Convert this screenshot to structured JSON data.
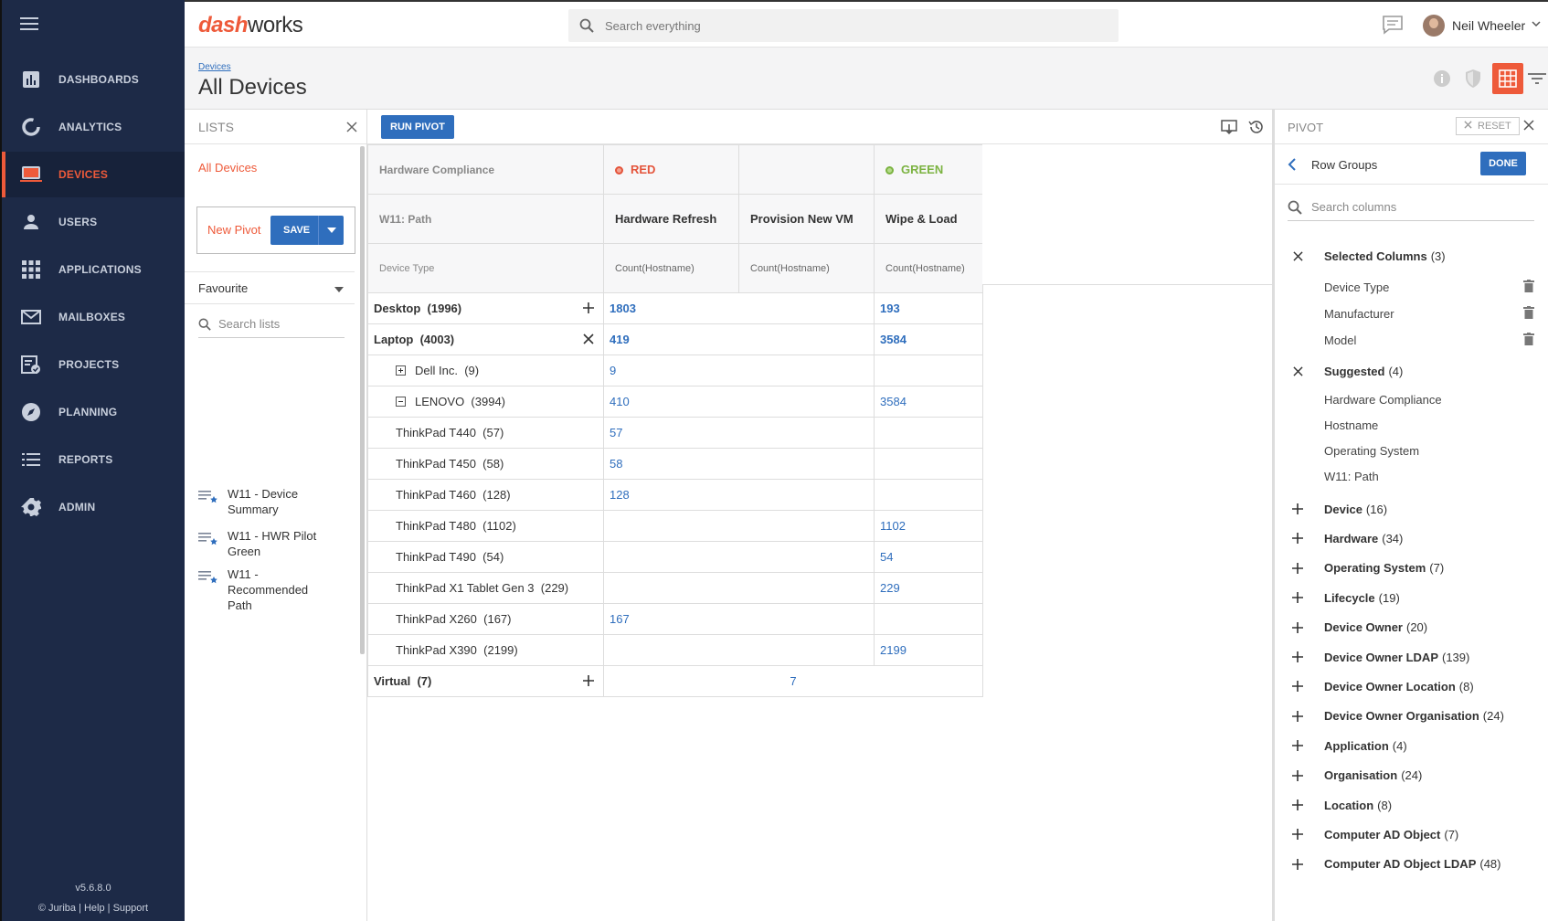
{
  "sidebar": {
    "menu_icon": "hamburger-icon",
    "items": [
      {
        "label": "DASHBOARDS",
        "icon": "bar-chart-icon"
      },
      {
        "label": "ANALYTICS",
        "icon": "donut-icon"
      },
      {
        "label": "DEVICES",
        "icon": "laptop-icon"
      },
      {
        "label": "USERS",
        "icon": "person-icon"
      },
      {
        "label": "APPLICATIONS",
        "icon": "apps-grid-icon"
      },
      {
        "label": "MAILBOXES",
        "icon": "mail-icon"
      },
      {
        "label": "PROJECTS",
        "icon": "clipboard-check-icon"
      },
      {
        "label": "PLANNING",
        "icon": "compass-icon"
      },
      {
        "label": "REPORTS",
        "icon": "list-icon"
      },
      {
        "label": "ADMIN",
        "icon": "gear-icon"
      }
    ],
    "active": "DEVICES",
    "version": "v5.6.8.0",
    "footer": "© Juriba | Help | Support"
  },
  "topbar": {
    "logo_a": "dash",
    "logo_b": "works",
    "search_placeholder": "Search everything",
    "user_name": "Neil Wheeler"
  },
  "header": {
    "breadcrumb": "Devices",
    "title": "All Devices"
  },
  "lists": {
    "title": "LISTS",
    "all_devices": "All Devices",
    "new_pivot": "New Pivot",
    "save": "SAVE",
    "favourite": "Favourite",
    "search_placeholder": "Search lists",
    "entries": [
      {
        "line1": "W11 - Device",
        "line2": "Summary",
        "line3": ""
      },
      {
        "line1": "W11 - HWR Pilot",
        "line2": "Green",
        "line3": ""
      },
      {
        "line1": "W11 -",
        "line2": "Recommended",
        "line3": "Path"
      }
    ]
  },
  "pivot": {
    "run_label": "RUN PIVOT",
    "col_group_1": "Hardware Compliance",
    "col_group_2": "W11: Path",
    "row_field": "Device Type",
    "red_label": "RED",
    "green_label": "GREEN",
    "red_color": "#e4543b",
    "green_color": "#7cb342",
    "cols": [
      "Hardware Refresh",
      "Provision New VM",
      "Wipe & Load"
    ],
    "agg": "Count(Hostname)",
    "rows": [
      {
        "label": "Desktop",
        "count": "(1996)",
        "level": "top",
        "action": "plus",
        "v1": "1803",
        "v2": "",
        "v3": "193"
      },
      {
        "label": "Laptop",
        "count": "(4003)",
        "level": "top",
        "action": "close",
        "v1": "419",
        "v2": "",
        "v3": "3584"
      },
      {
        "label": "Dell Inc.",
        "count": "(9)",
        "level": "child",
        "toggle": "plus",
        "v1": "9",
        "v2": "",
        "v3": ""
      },
      {
        "label": "LENOVO",
        "count": "(3994)",
        "level": "child",
        "toggle": "minus",
        "v1": "410",
        "v2": "",
        "v3": "3584"
      },
      {
        "label": "ThinkPad T440",
        "count": "(57)",
        "level": "grand",
        "v1": "57",
        "v2": "",
        "v3": ""
      },
      {
        "label": "ThinkPad T450",
        "count": "(58)",
        "level": "grand",
        "v1": "58",
        "v2": "",
        "v3": ""
      },
      {
        "label": "ThinkPad T460",
        "count": "(128)",
        "level": "grand",
        "v1": "128",
        "v2": "",
        "v3": ""
      },
      {
        "label": "ThinkPad T480",
        "count": "(1102)",
        "level": "grand",
        "v1": "",
        "v2": "",
        "v3": "1102"
      },
      {
        "label": "ThinkPad T490",
        "count": "(54)",
        "level": "grand",
        "v1": "",
        "v2": "",
        "v3": "54"
      },
      {
        "label": "ThinkPad X1 Tablet Gen 3",
        "count": "(229)",
        "level": "grand",
        "v1": "",
        "v2": "",
        "v3": "229"
      },
      {
        "label": "ThinkPad X260",
        "count": "(167)",
        "level": "grand",
        "v1": "167",
        "v2": "",
        "v3": ""
      },
      {
        "label": "ThinkPad X390",
        "count": "(2199)",
        "level": "grand",
        "v1": "",
        "v2": "",
        "v3": "2199"
      },
      {
        "label": "Virtual",
        "count": "(7)",
        "level": "top",
        "action": "plus",
        "v1": "",
        "v2": "7",
        "v3": ""
      }
    ]
  },
  "panel": {
    "title": "PIVOT",
    "reset": "RESET",
    "row_groups": "Row Groups",
    "done": "DONE",
    "search_placeholder": "Search columns",
    "selected_title": "Selected Columns",
    "selected_count": "(3)",
    "selected": [
      "Device Type",
      "Manufacturer",
      "Model"
    ],
    "suggested_title": "Suggested",
    "suggested_count": "(4)",
    "suggested": [
      "Hardware Compliance",
      "Hostname",
      "Operating System",
      "W11: Path"
    ],
    "groups": [
      {
        "name": "Device",
        "count": "(16)"
      },
      {
        "name": "Hardware",
        "count": "(34)"
      },
      {
        "name": "Operating System",
        "count": "(7)"
      },
      {
        "name": "Lifecycle",
        "count": "(19)"
      },
      {
        "name": "Device Owner",
        "count": "(20)"
      },
      {
        "name": "Device Owner LDAP",
        "count": "(139)"
      },
      {
        "name": "Device Owner Location",
        "count": "(8)"
      },
      {
        "name": "Device Owner Organisation",
        "count": "(24)"
      },
      {
        "name": "Application",
        "count": "(4)"
      },
      {
        "name": "Organisation",
        "count": "(24)"
      },
      {
        "name": "Location",
        "count": "(8)"
      },
      {
        "name": "Computer AD Object",
        "count": "(7)"
      },
      {
        "name": "Computer AD Object LDAP",
        "count": "(48)"
      }
    ]
  }
}
